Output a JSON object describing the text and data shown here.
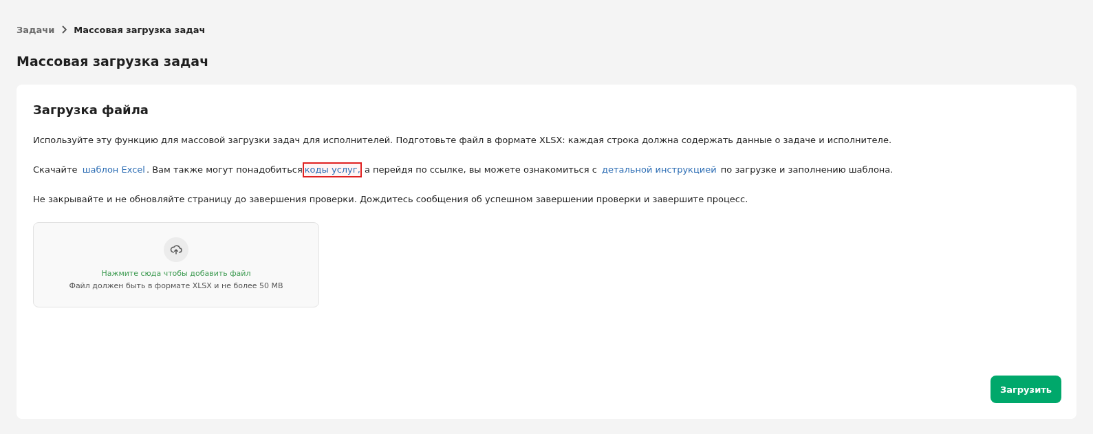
{
  "breadcrumbs": [
    {
      "label": "Задачи",
      "current": false
    },
    {
      "label": "Массовая загрузка задач",
      "current": true
    }
  ],
  "page_title": "Массовая загрузка задач",
  "card": {
    "title": "Загрузка файла",
    "paragraphs": [
      [
        {
          "kind": "text",
          "text": "Используйте эту функцию для массовой загрузки задач для исполнителей. Подготовьте файл в формате XLSX: каждая строка должна содержать данные о задаче и исполнителе."
        }
      ],
      [
        {
          "kind": "text",
          "text": "Скачайте "
        },
        {
          "kind": "link",
          "text": "шаблон Excel",
          "highlighted": false
        },
        {
          "kind": "text",
          "text": ". Вам также могут понадобиться"
        },
        {
          "kind": "link",
          "text": "коды услуг,",
          "highlighted": true
        },
        {
          "kind": "text",
          "text": " а перейдя по ссылке, вы можете ознакомиться с "
        },
        {
          "kind": "link",
          "text": "детальной инструкцией",
          "highlighted": false
        },
        {
          "kind": "text",
          "text": " по загрузке и заполнению шаблона."
        }
      ],
      [
        {
          "kind": "text",
          "text": "Не закрывайте и не обновляйте страницу до завершения проверки. Дождитесь сообщения об успешном завершении проверки и завершите процесс."
        }
      ]
    ],
    "dropzone": {
      "action": "Нажмите сюда чтобы добавить файл",
      "hint": "Файл должен быть в формате XLSX и не более 50 MB"
    },
    "submit_button": "Загрузить"
  }
}
